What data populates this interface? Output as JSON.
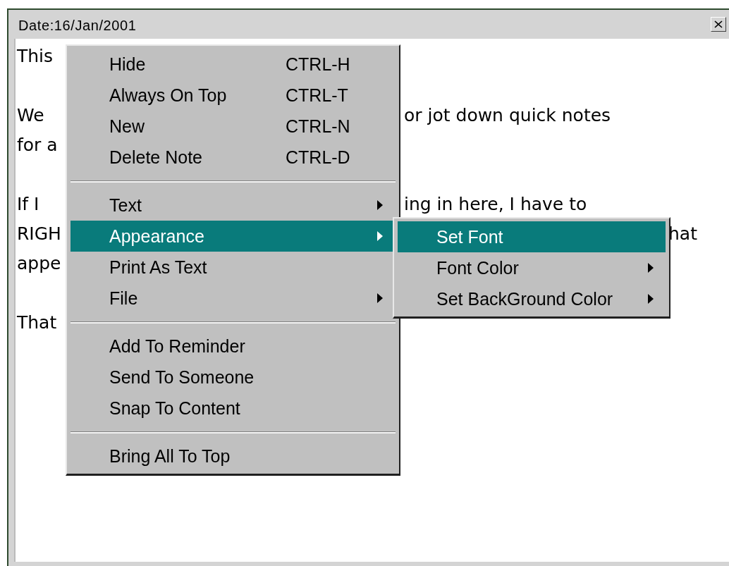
{
  "window": {
    "title": "Date:16/Jan/2001"
  },
  "note": {
    "paragraphs": [
      [
        {
          "start": "This"
        }
      ],
      [
        {
          "start": "We",
          "middle": "or jot down quick notes"
        },
        {
          "start": "for a"
        }
      ],
      [
        {
          "start": "If I",
          "middle": "ing in here, I have to"
        },
        {
          "start": "RIGH",
          "end": "hat"
        },
        {
          "start": "appe"
        }
      ],
      [
        {
          "start": "That"
        }
      ]
    ]
  },
  "context_menu": {
    "sections": [
      {
        "items": [
          {
            "label": "Hide",
            "shortcut": "CTRL-H",
            "has_submenu": false,
            "selected": false
          },
          {
            "label": "Always On Top",
            "shortcut": "CTRL-T",
            "has_submenu": false,
            "selected": false
          },
          {
            "label": "New",
            "shortcut": "CTRL-N",
            "has_submenu": false,
            "selected": false
          },
          {
            "label": "Delete Note",
            "shortcut": "CTRL-D",
            "has_submenu": false,
            "selected": false
          }
        ]
      },
      {
        "items": [
          {
            "label": "Text",
            "has_submenu": true,
            "selected": false
          },
          {
            "label": "Appearance",
            "has_submenu": true,
            "selected": true
          },
          {
            "label": "Print As Text",
            "has_submenu": false,
            "selected": false
          },
          {
            "label": "File",
            "has_submenu": true,
            "selected": false
          }
        ]
      },
      {
        "items": [
          {
            "label": "Add To Reminder",
            "has_submenu": false,
            "selected": false
          },
          {
            "label": "Send To Someone",
            "has_submenu": false,
            "selected": false
          },
          {
            "label": "Snap To Content",
            "has_submenu": false,
            "selected": false
          }
        ]
      },
      {
        "items": [
          {
            "label": "Bring All To Top",
            "has_submenu": false,
            "selected": false
          }
        ]
      }
    ]
  },
  "submenu": {
    "items": [
      {
        "label": "Set Font",
        "has_submenu": false,
        "selected": true
      },
      {
        "label": "Font Color",
        "has_submenu": true,
        "selected": false
      },
      {
        "label": "Set BackGround Color",
        "has_submenu": true,
        "selected": false
      }
    ]
  }
}
